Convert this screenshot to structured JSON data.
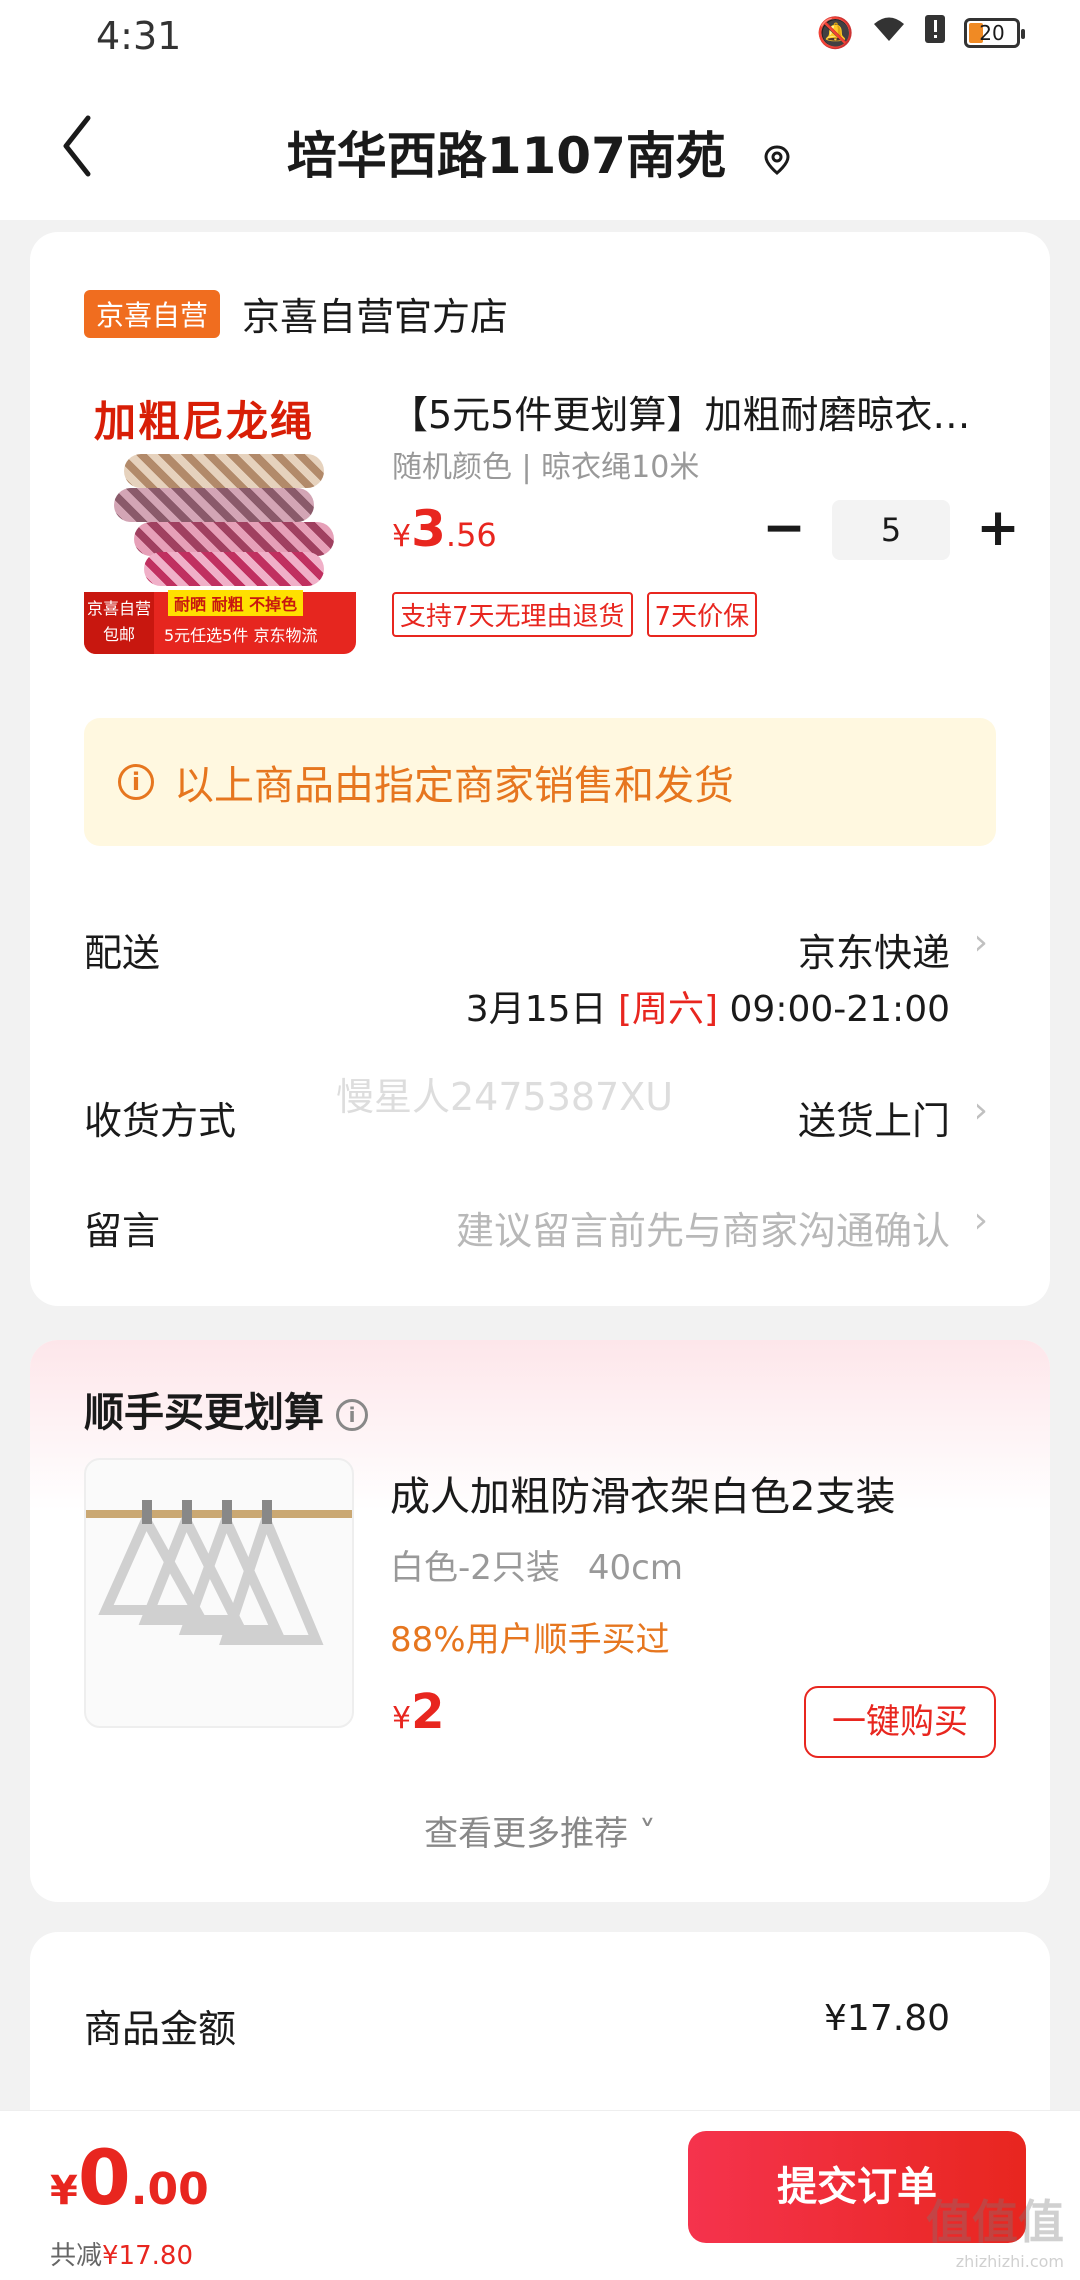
{
  "status_bar": {
    "time": "4:31",
    "battery": "20"
  },
  "header": {
    "title": "培华西路1107南苑"
  },
  "store": {
    "tag": "京喜自营",
    "name": "京喜自营官方店"
  },
  "product": {
    "image_text": "加粗尼龙绳",
    "image_badge": "京喜自营 包邮",
    "image_tags": "耐晒 耐粗 不掉色",
    "image_footer": "5元任选5件 京东物流",
    "title": "【5元5件更划算】加粗耐磨晾衣…",
    "spec": "随机颜色 | 晾衣绳10米",
    "price_symbol": "¥",
    "price_int": "3",
    "price_dec": ".56",
    "quantity": "5",
    "minus": "−",
    "plus": "+",
    "service_tags": [
      "支持7天无理由退货",
      "7天价保"
    ]
  },
  "notice": {
    "icon": "i",
    "text": "以上商品由指定商家销售和发货"
  },
  "delivery": {
    "label": "配送",
    "value": "京东快递",
    "date": "3月15日",
    "weekday": "[周六]",
    "time": "09:00-21:00"
  },
  "receive": {
    "label": "收货方式",
    "value": "送货上门"
  },
  "message": {
    "label": "留言",
    "placeholder": "建议留言前先与商家沟通确认"
  },
  "watermark": "慢星人2475387XU",
  "recommend": {
    "section_title": "顺手买更划算",
    "title": "成人加粗防滑衣架白色2支装",
    "spec_color": "白色-2只装",
    "spec_size": "40cm",
    "hint": "88%用户顺手买过",
    "price_symbol": "¥",
    "price_int": "2",
    "buy_label": "一键购买",
    "more": "查看更多推荐"
  },
  "summary": {
    "label": "商品金额",
    "value": "¥17.80"
  },
  "bottom": {
    "price_symbol": "¥",
    "price_int": "0",
    "price_dec": ".00",
    "saved_label": "共减",
    "saved_amount": "¥17.80",
    "submit_label": "提交订单"
  },
  "corner_mark": {
    "text": "值值值",
    "sub": "zhizhizhi.com"
  },
  "colors": {
    "accent": "#e8261f",
    "orange": "#e6761f",
    "store_tag": "#f06d1f"
  }
}
